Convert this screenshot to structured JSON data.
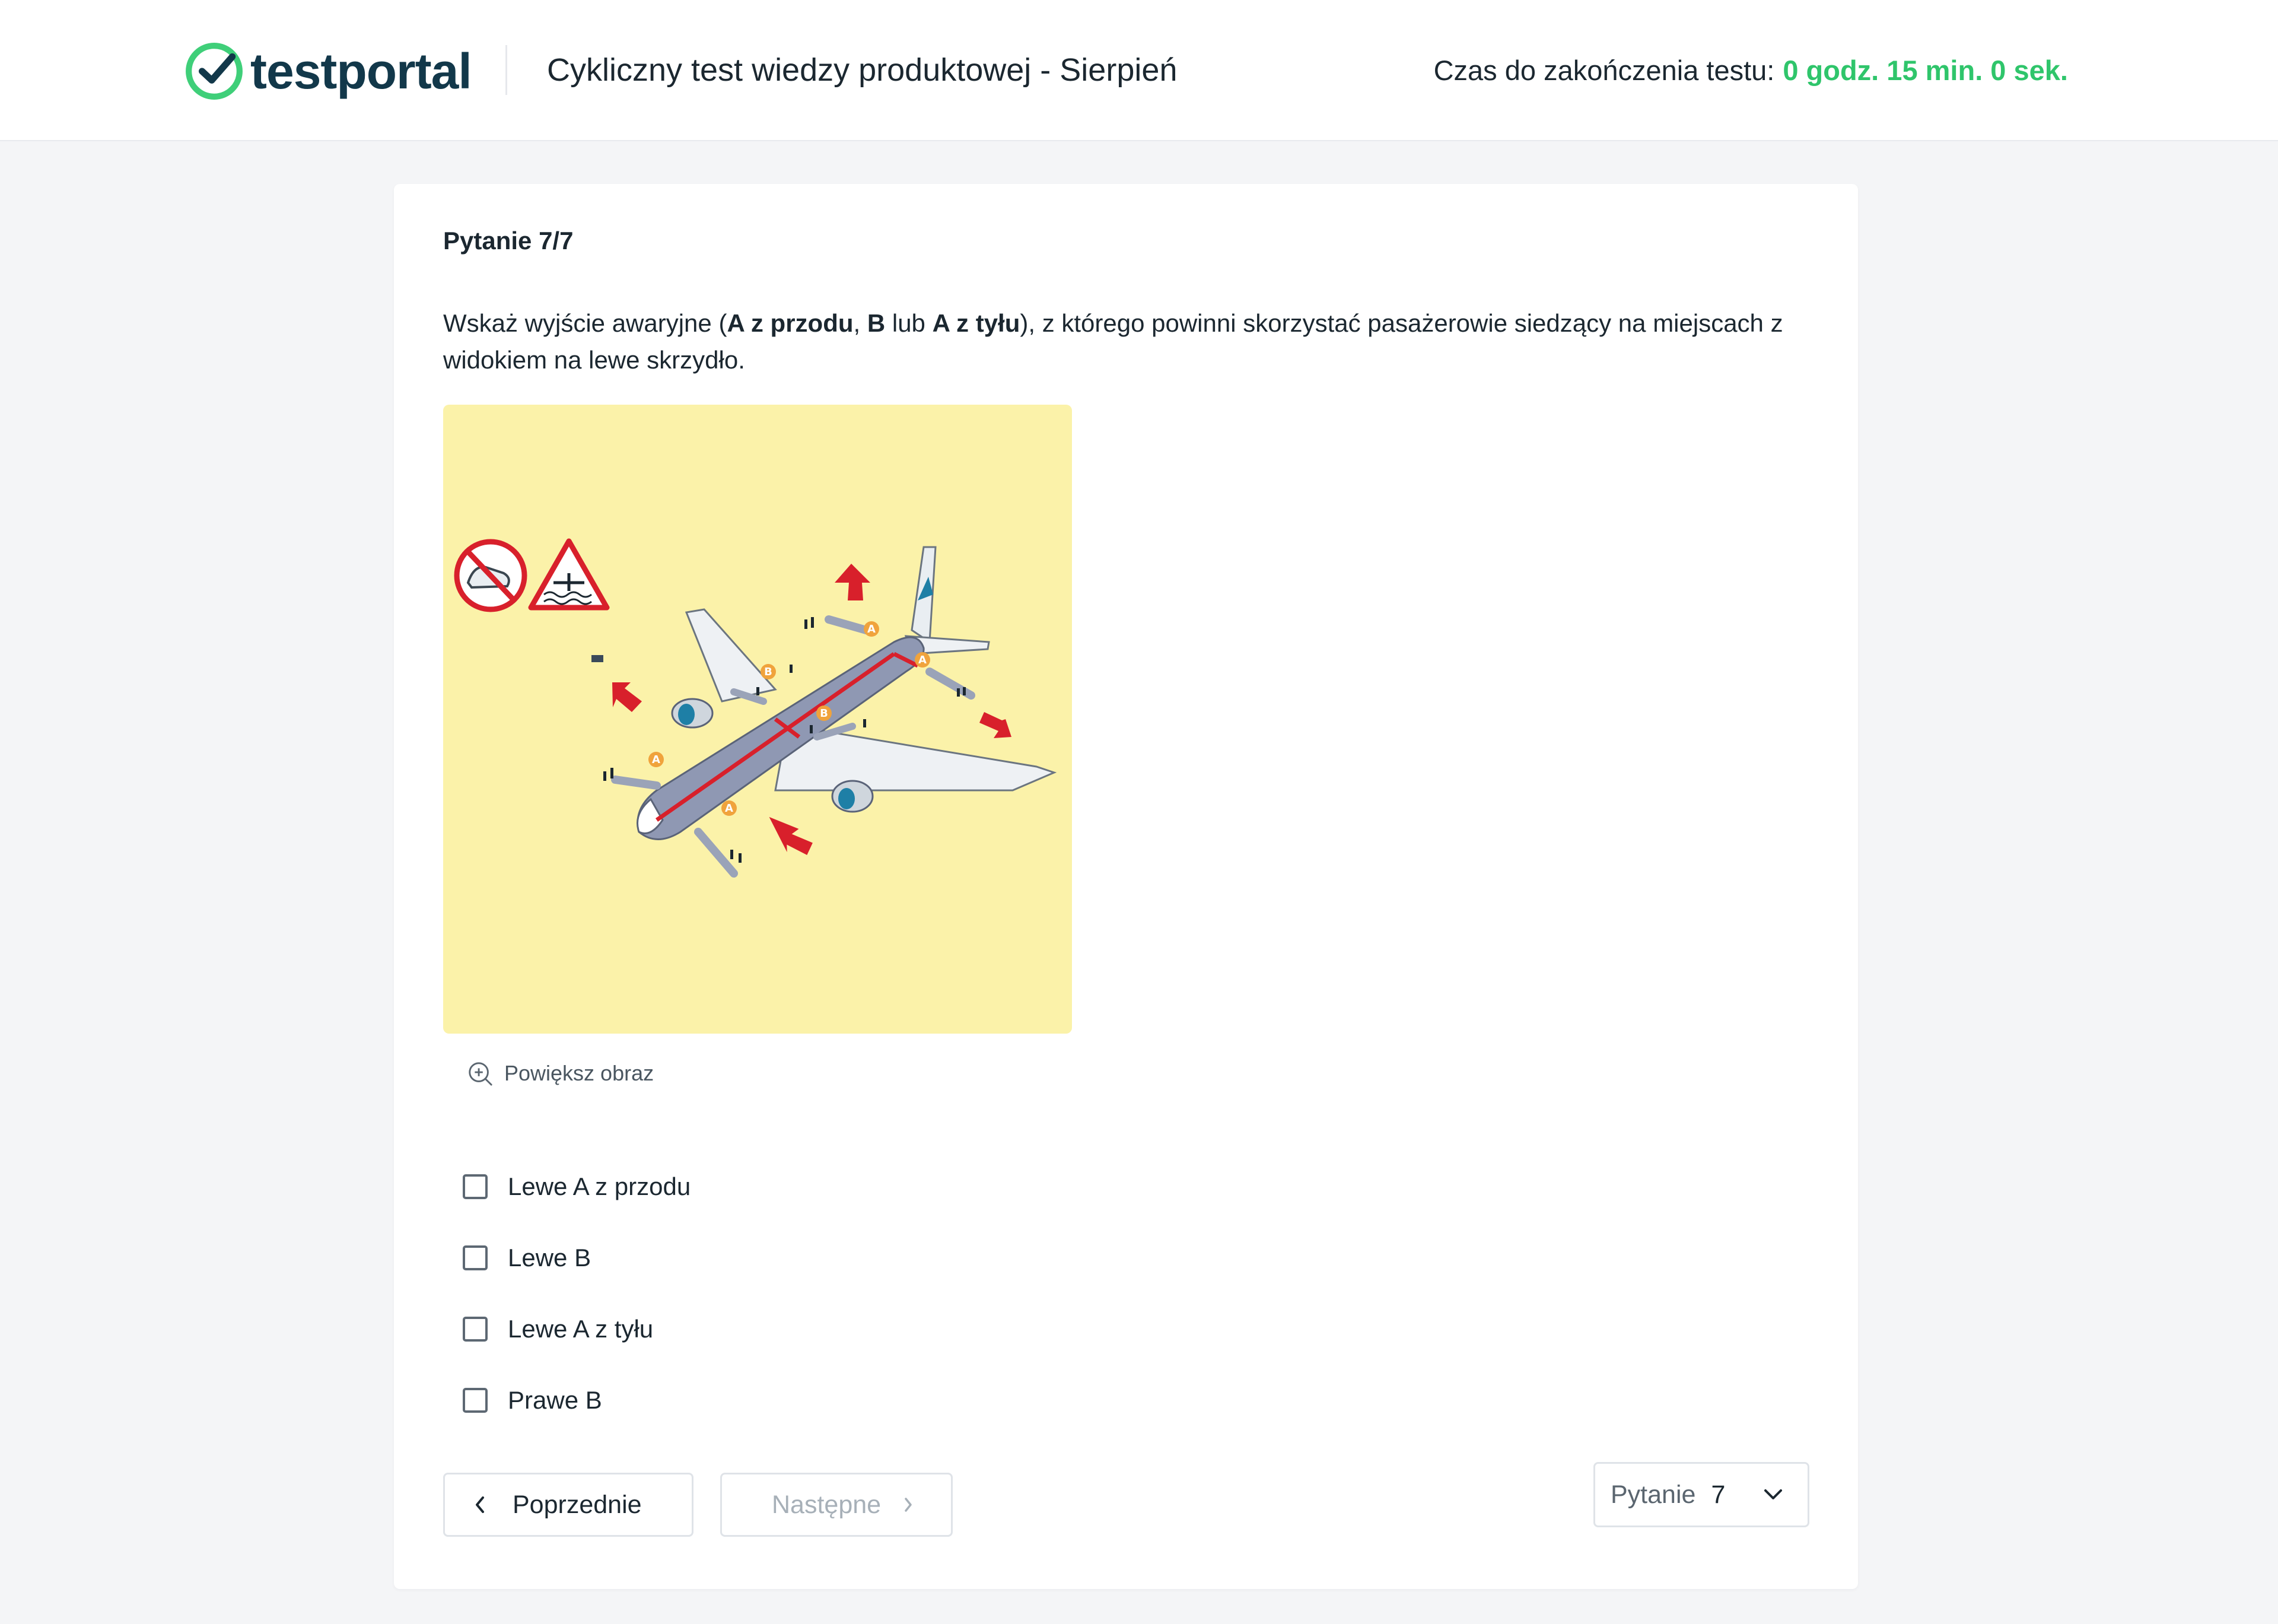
{
  "header": {
    "brand": "testportal",
    "title": "Cykliczny test wiedzy produktowej - Sierpień",
    "timer_label": "Czas do zakończenia testu:",
    "timer_value": "0 godz. 15 min. 0 sek.",
    "accent_color": "#2fc56b"
  },
  "question": {
    "number": "Pytanie 7/7",
    "text_parts": [
      "Wskaż wyjście awaryjne (",
      "A z przodu",
      ", ",
      "B",
      " lub ",
      "A z tyłu",
      "), z którego powinni skorzystać pasażerowie siedzący na miejscach z widokiem na lewe skrzydło."
    ],
    "image": {
      "description_icons": [
        "no-shoes-icon",
        "water-landing-warning-icon",
        "airplane-evacuation-diagram"
      ],
      "exit_labels": [
        "A",
        "B",
        "B",
        "A",
        "A",
        "A"
      ]
    },
    "zoom_label": "Powiększ obraz",
    "options": [
      {
        "label": "Lewe A z przodu",
        "checked": false
      },
      {
        "label": "Lewe B",
        "checked": false
      },
      {
        "label": "Lewe A z tyłu",
        "checked": false
      },
      {
        "label": "Prawe B",
        "checked": false
      }
    ]
  },
  "navigation": {
    "prev_label": "Poprzednie",
    "next_label": "Następne",
    "next_disabled": true,
    "select_label": "Pytanie",
    "select_value": "7"
  }
}
